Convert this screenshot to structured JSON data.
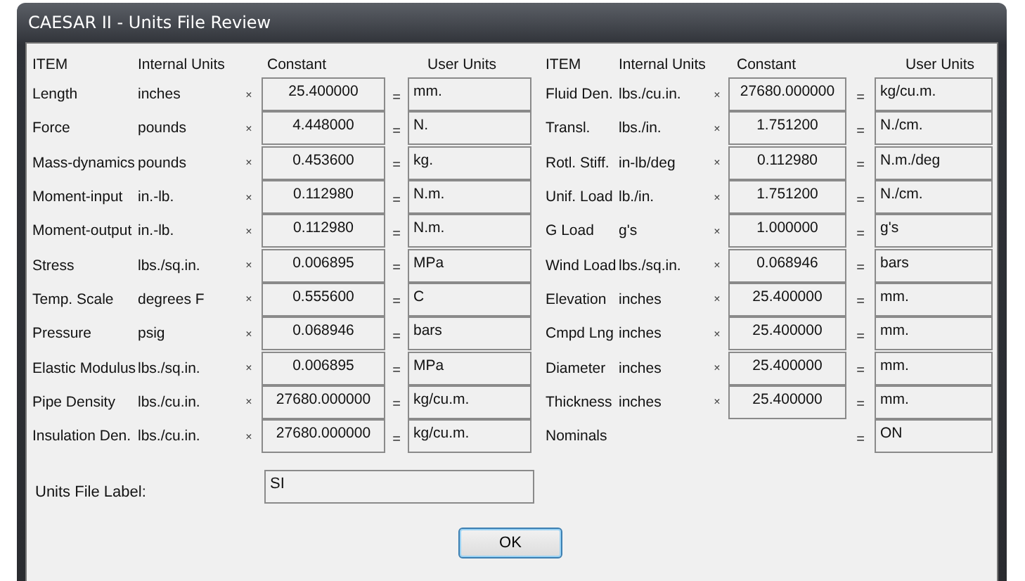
{
  "window": {
    "title": "CAESAR II  -  Units File Review"
  },
  "tables": [
    {
      "headers": [
        "ITEM",
        "Internal Units",
        "Constant",
        "User Units"
      ],
      "rows": [
        {
          "item": "Length",
          "internal": "inches",
          "op": "×",
          "constant": "25.400000",
          "eq": "=",
          "user": "mm."
        },
        {
          "item": "Force",
          "internal": "pounds",
          "op": "×",
          "constant": "4.448000",
          "eq": "=",
          "user": "N."
        },
        {
          "item": "Mass-dynamics",
          "internal": "pounds",
          "op": "×",
          "constant": "0.453600",
          "eq": "=",
          "user": "kg."
        },
        {
          "item": "Moment-input",
          "internal": "in.-lb.",
          "op": "×",
          "constant": "0.112980",
          "eq": "=",
          "user": "N.m."
        },
        {
          "item": "Moment-output",
          "internal": "in.-lb.",
          "op": "×",
          "constant": "0.112980",
          "eq": "=",
          "user": "N.m."
        },
        {
          "item": "Stress",
          "internal": "lbs./sq.in.",
          "op": "×",
          "constant": "0.006895",
          "eq": "=",
          "user": "MPa"
        },
        {
          "item": "Temp. Scale",
          "internal": "degrees F",
          "op": "×",
          "constant": "0.555600",
          "eq": "=",
          "user": "C"
        },
        {
          "item": "Pressure",
          "internal": "psig",
          "op": "×",
          "constant": "0.068946",
          "eq": "=",
          "user": "bars"
        },
        {
          "item": "Elastic Modulus",
          "internal": "lbs./sq.in.",
          "op": "×",
          "constant": "0.006895",
          "eq": "=",
          "user": "MPa"
        },
        {
          "item": "Pipe Density",
          "internal": "lbs./cu.in.",
          "op": "×",
          "constant": "27680.000000",
          "eq": "=",
          "user": "kg/cu.m."
        },
        {
          "item": "Insulation Den.",
          "internal": "lbs./cu.in.",
          "op": "×",
          "constant": "27680.000000",
          "eq": "=",
          "user": "kg/cu.m."
        }
      ]
    },
    {
      "headers": [
        "ITEM",
        "Internal Units",
        "Constant",
        "User Units"
      ],
      "rows": [
        {
          "item": "Fluid Den.",
          "internal": "lbs./cu.in.",
          "op": "×",
          "constant": "27680.000000",
          "eq": "=",
          "user": "kg/cu.m."
        },
        {
          "item": "Transl.",
          "internal": "lbs./in.",
          "op": "×",
          "constant": "1.751200",
          "eq": "=",
          "user": "N./cm."
        },
        {
          "item": "Rotl. Stiff.",
          "internal": "in-lb/deg",
          "op": "×",
          "constant": "0.112980",
          "eq": "=",
          "user": "N.m./deg"
        },
        {
          "item": "Unif. Load",
          "internal": "lb./in.",
          "op": "×",
          "constant": "1.751200",
          "eq": "=",
          "user": "N./cm."
        },
        {
          "item": "G Load",
          "internal": "g's",
          "op": "×",
          "constant": "1.000000",
          "eq": "=",
          "user": "g's"
        },
        {
          "item": "Wind Load",
          "internal": "lbs./sq.in.",
          "op": "×",
          "constant": "0.068946",
          "eq": "=",
          "user": "bars"
        },
        {
          "item": "Elevation",
          "internal": "inches",
          "op": "×",
          "constant": "25.400000",
          "eq": "=",
          "user": "mm."
        },
        {
          "item": "Cmpd Lng",
          "internal": "inches",
          "op": "×",
          "constant": "25.400000",
          "eq": "=",
          "user": "mm."
        },
        {
          "item": "Diameter",
          "internal": "inches",
          "op": "×",
          "constant": "25.400000",
          "eq": "=",
          "user": "mm."
        },
        {
          "item": "Thickness",
          "internal": "inches",
          "op": "×",
          "constant": "25.400000",
          "eq": "=",
          "user": "mm."
        },
        {
          "item": "Nominals",
          "eq": "=",
          "user": "ON"
        }
      ]
    }
  ],
  "units_file_label": {
    "label": "Units File Label:",
    "value": "SI"
  },
  "buttons": [
    "OK"
  ]
}
